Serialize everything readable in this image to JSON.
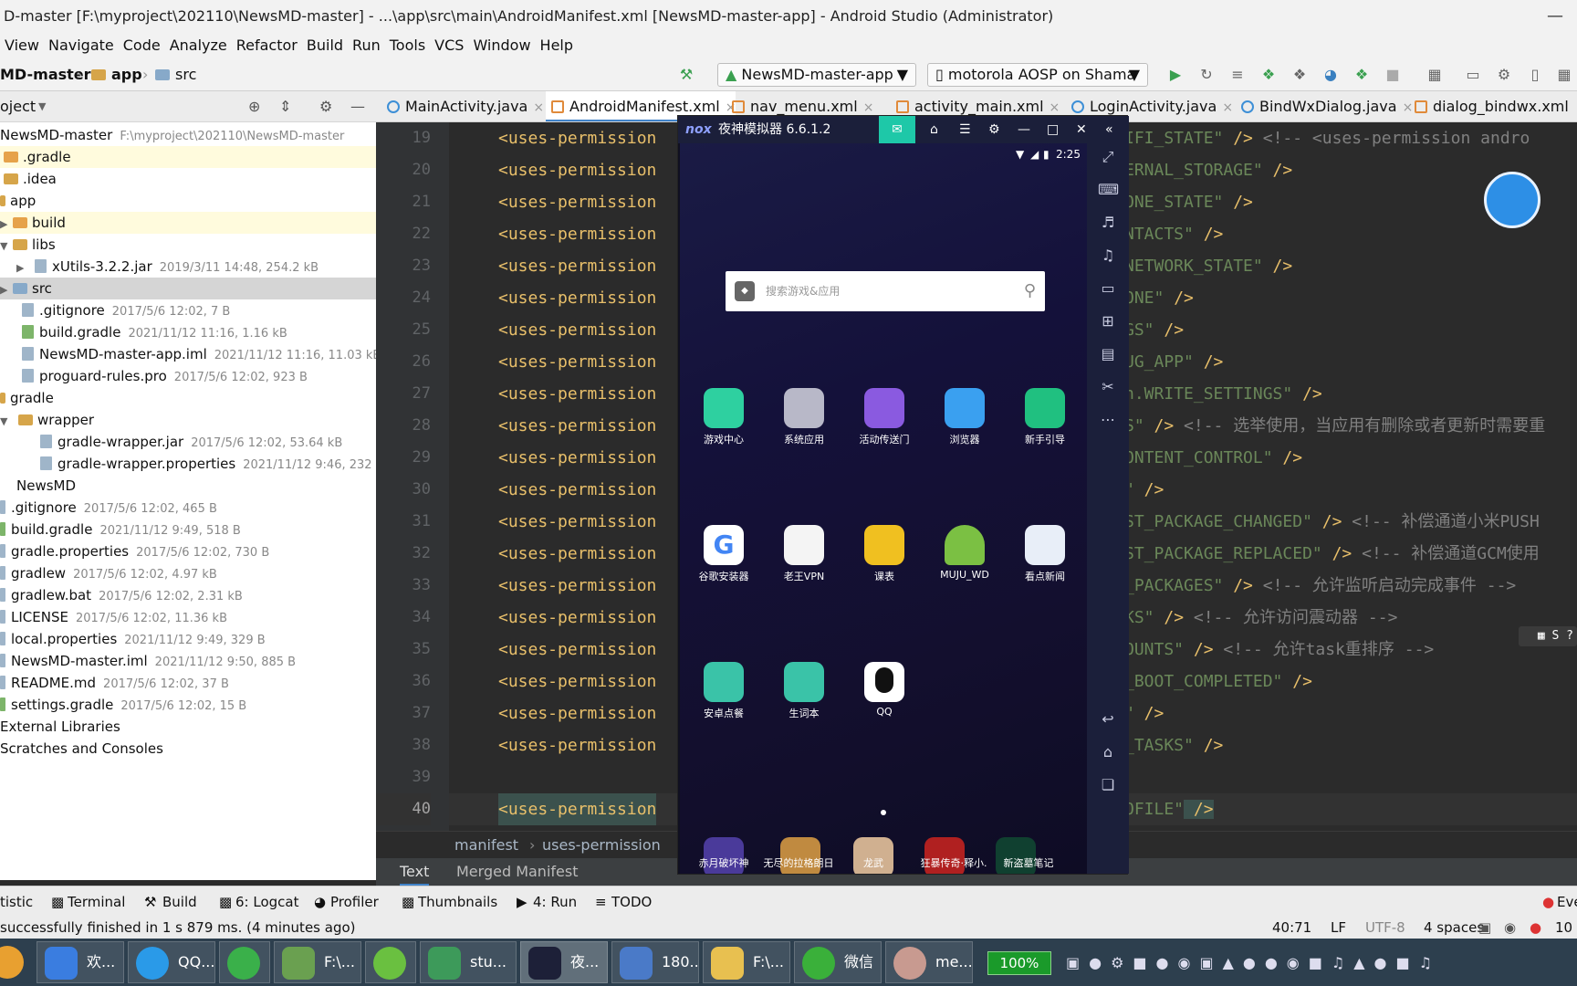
{
  "window": {
    "title": "D-master [F:\\myproject\\202110\\NewsMD-master] - ...\\app\\src\\main\\AndroidManifest.xml [NewsMD-master-app] - Android Studio (Administrator)",
    "min_icon": "minimize-icon"
  },
  "menu": [
    "View",
    "Navigate",
    "Code",
    "Analyze",
    "Refactor",
    "Build",
    "Run",
    "Tools",
    "VCS",
    "Window",
    "Help"
  ],
  "nav": {
    "crumbs": [
      "MD-master",
      "app",
      "src"
    ],
    "run_config": "NewsMD-master-app",
    "device": "motorola AOSP on Shama"
  },
  "project_panel": {
    "title": "oject",
    "root_name": "NewsMD-master",
    "root_path": "F:\\myproject\\202110\\NewsMD-master",
    "items": [
      {
        "name": ".gradle",
        "meta": ""
      },
      {
        "name": ".idea",
        "meta": ""
      },
      {
        "name": "app",
        "meta": ""
      },
      {
        "name": "build",
        "meta": ""
      },
      {
        "name": "libs",
        "meta": ""
      },
      {
        "name": "xUtils-3.2.2.jar",
        "meta": "2019/3/11 14:48, 254.2 kB"
      },
      {
        "name": "src",
        "meta": ""
      },
      {
        "name": ".gitignore",
        "meta": "2017/5/6 12:02, 7 B"
      },
      {
        "name": "build.gradle",
        "meta": "2021/11/12 11:16, 1.16 kB"
      },
      {
        "name": "NewsMD-master-app.iml",
        "meta": "2021/11/12 11:16, 11.03 kB"
      },
      {
        "name": "proguard-rules.pro",
        "meta": "2017/5/6 12:02, 923 B"
      },
      {
        "name": "gradle",
        "meta": ""
      },
      {
        "name": "wrapper",
        "meta": ""
      },
      {
        "name": "gradle-wrapper.jar",
        "meta": "2017/5/6 12:02, 53.64 kB"
      },
      {
        "name": "gradle-wrapper.properties",
        "meta": "2021/11/12 9:46, 232"
      },
      {
        "name": "NewsMD",
        "meta": ""
      },
      {
        "name": ".gitignore",
        "meta": "2017/5/6 12:02, 465 B"
      },
      {
        "name": "build.gradle",
        "meta": "2021/11/12 9:49, 518 B"
      },
      {
        "name": "gradle.properties",
        "meta": "2017/5/6 12:02, 730 B"
      },
      {
        "name": "gradlew",
        "meta": "2017/5/6 12:02, 4.97 kB"
      },
      {
        "name": "gradlew.bat",
        "meta": "2017/5/6 12:02, 2.31 kB"
      },
      {
        "name": "LICENSE",
        "meta": "2017/5/6 12:02, 11.36 kB"
      },
      {
        "name": "local.properties",
        "meta": "2021/11/12 9:49, 329 B"
      },
      {
        "name": "NewsMD-master.iml",
        "meta": "2021/11/12 9:50, 885 B"
      },
      {
        "name": "README.md",
        "meta": "2017/5/6 12:02, 37 B"
      },
      {
        "name": "settings.gradle",
        "meta": "2017/5/6 12:02, 15 B"
      },
      {
        "name": "External Libraries",
        "meta": ""
      },
      {
        "name": "Scratches and Consoles",
        "meta": ""
      }
    ]
  },
  "tabs": [
    "MainActivity.java",
    "AndroidManifest.xml",
    "nav_menu.xml",
    "activity_main.xml",
    "LoginActivity.java",
    "BindWxDialog.java",
    "dialog_bindwx.xml"
  ],
  "editor": {
    "line_numbers": [
      "19",
      "20",
      "21",
      "22",
      "23",
      "24",
      "25",
      "26",
      "27",
      "28",
      "29",
      "30",
      "31",
      "32",
      "33",
      "34",
      "35",
      "36",
      "37",
      "38",
      "39",
      "40"
    ],
    "left_text": "<uses-permission",
    "right_lines": [
      {
        "str": "IFI_STATE\"",
        "rest": " /> ",
        "cmt": "<!-- <uses-permission andro"
      },
      {
        "str": "ERNAL_STORAGE\"",
        "rest": " />",
        "cmt": ""
      },
      {
        "str": "ONE_STATE\"",
        "rest": " />",
        "cmt": ""
      },
      {
        "str": "NTACTS\"",
        "rest": " />",
        "cmt": ""
      },
      {
        "str": "NETWORK_STATE\"",
        "rest": " />",
        "cmt": ""
      },
      {
        "str": "ONE\"",
        "rest": " />",
        "cmt": ""
      },
      {
        "str": "GS\"",
        "rest": " />",
        "cmt": ""
      },
      {
        "str": "UG_APP\"",
        "rest": " />",
        "cmt": ""
      },
      {
        "str": "n.WRITE_SETTINGS\"",
        "rest": " />",
        "cmt": ""
      },
      {
        "str": "S\"",
        "rest": " /> ",
        "cmt": "<!-- 选举使用，当应用有删除或者更新时需要重"
      },
      {
        "str": "ONTENT_CONTROL\"",
        "rest": " />",
        "cmt": ""
      },
      {
        "str": "\"",
        "rest": " />",
        "cmt": ""
      },
      {
        "str": "ST_PACKAGE_CHANGED\"",
        "rest": " /> ",
        "cmt": "<!-- 补偿通道小米PUSH"
      },
      {
        "str": "ST_PACKAGE_REPLACED\"",
        "rest": " /> ",
        "cmt": "<!-- 补偿通道GCM使用"
      },
      {
        "str": "_PACKAGES\"",
        "rest": " /> ",
        "cmt": "<!-- 允许监听启动完成事件 -->"
      },
      {
        "str": "KS\"",
        "rest": " /> ",
        "cmt": "<!-- 允许访问震动器 -->"
      },
      {
        "str": "OUNTS\"",
        "rest": " /> ",
        "cmt": "<!-- 允许task重排序 -->"
      },
      {
        "str": "_BOOT_COMPLETED\"",
        "rest": " />",
        "cmt": ""
      },
      {
        "str": "\"",
        "rest": " />",
        "cmt": ""
      },
      {
        "str": "_TASKS\"",
        "rest": " />",
        "cmt": ""
      },
      {
        "str": "",
        "rest": "",
        "cmt": ""
      },
      {
        "str": "OFILE\"",
        "rest": " />",
        "cmt": ""
      }
    ]
  },
  "editor_breadcrumb": [
    "manifest",
    "uses-permission"
  ],
  "editor_bottom_tabs": [
    "Text",
    "Merged Manifest"
  ],
  "tool_windows": [
    "tistic",
    "Terminal",
    "Build",
    "6: Logcat",
    "Profiler",
    "Thumbnails",
    "4: Run",
    "TODO"
  ],
  "tool_right": "Eve",
  "status": {
    "message": "successfully finished in 1 s 879 ms. (4 minutes ago)",
    "position": "40:71",
    "line_sep": "LF",
    "encoding": "UTF-8",
    "indent": "4 spaces",
    "extra": "10"
  },
  "emulator": {
    "title": "夜神模拟器 6.6.1.2",
    "logo": "nox",
    "clock": "2:25",
    "search_placeholder": "搜索游戏&应用",
    "apps_row1": [
      "游戏中心",
      "系统应用",
      "活动传送门",
      "浏览器",
      "新手引导"
    ],
    "apps_row2": [
      "谷歌安装器",
      "老王VPN",
      "课表",
      "MUJU_WD",
      "看点新闻"
    ],
    "apps_row3": [
      "安卓点餐",
      "生词本",
      "QQ"
    ],
    "dock": [
      "赤月破坏神",
      "无尽的拉格朗日",
      "龙武",
      "狂暴传奇·释小.",
      "新盗墓笔记"
    ],
    "icon_colors": {
      "游戏中心": "#2ed0a0",
      "系统应用": "#b8b8c8",
      "活动传送门": "#8a5ae0",
      "浏览器": "#3aa0f0",
      "新手引导": "#20c080",
      "谷歌安装器": "#ffffff",
      "老王VPN": "#f4f4f4",
      "课表": "#f0c020",
      "MUJU_WD": "#7bc043",
      "看点新闻": "#e8eef8",
      "安卓点餐": "#3ac3a8",
      "生词本": "#3ac3a8",
      "QQ": "#ffffff"
    }
  },
  "taskbar": {
    "items": [
      "欢...",
      "QQ...",
      "",
      "F:\\...",
      "",
      "stu...",
      "夜...",
      "180...",
      "F:\\...",
      "微信",
      "me..."
    ],
    "tray_percent": "100%"
  }
}
